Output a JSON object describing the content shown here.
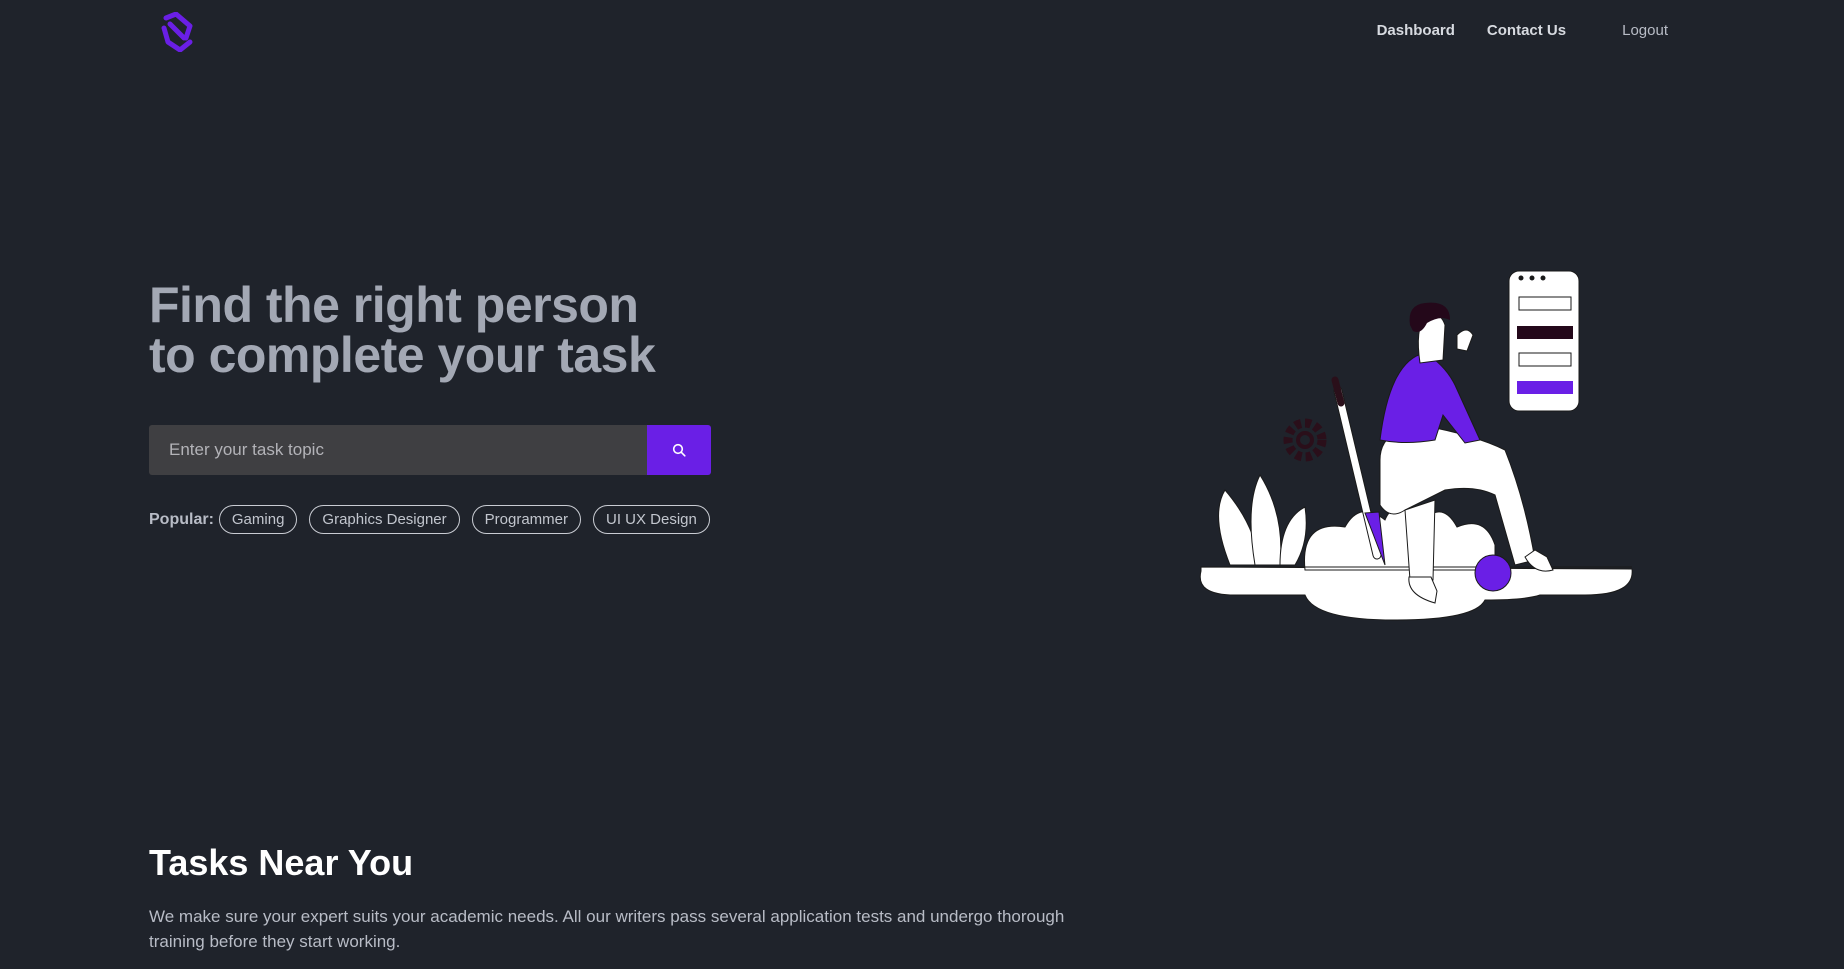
{
  "header": {
    "logo_icon": "brand-logo-icon",
    "nav": {
      "dashboard": "Dashboard",
      "contact": "Contact Us",
      "logout": "Logout"
    }
  },
  "hero": {
    "title_line1": "Find the right person",
    "title_line2": "to complete your task",
    "search": {
      "placeholder": "Enter your task topic",
      "value": "",
      "button_icon": "search-icon"
    },
    "popular": {
      "label": "Popular:",
      "tags": [
        "Gaming",
        "Graphics Designer",
        "Programmer",
        "UI UX Design"
      ]
    },
    "illustration_icon": "person-with-phone-illustration"
  },
  "section": {
    "title": "Tasks Near You",
    "description": "We make sure your expert suits your academic needs. All our writers pass several application tests and undergo thorough training before they start working."
  },
  "colors": {
    "background": "#1f232b",
    "accent": "#6a1fe6",
    "title_muted": "#a3a8b4"
  }
}
